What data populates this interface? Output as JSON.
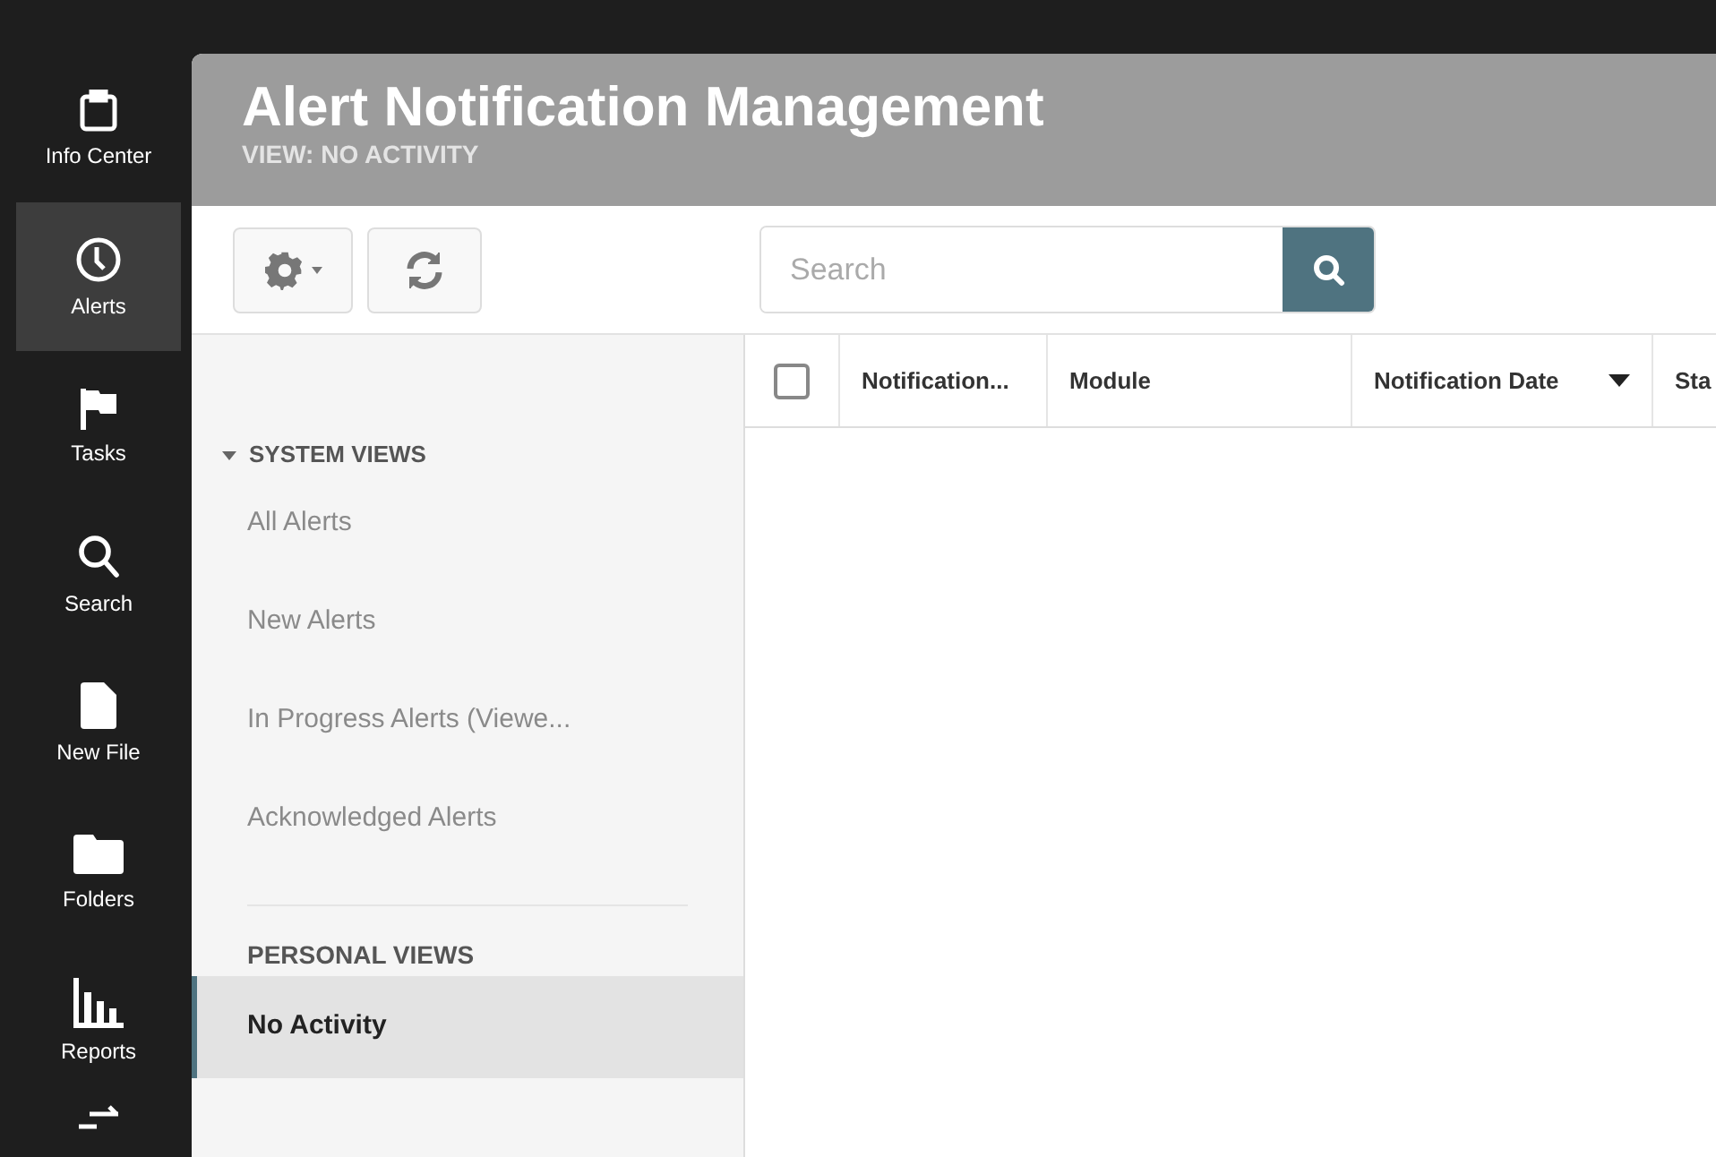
{
  "nav": [
    {
      "label": "Info Center",
      "kind": "clipboard",
      "selected": false
    },
    {
      "label": "Alerts",
      "kind": "clock",
      "selected": true
    },
    {
      "label": "Tasks",
      "kind": "flag",
      "selected": false
    },
    {
      "label": "Search",
      "kind": "search",
      "selected": false
    },
    {
      "label": "New File",
      "kind": "file",
      "selected": false
    },
    {
      "label": "Folders",
      "kind": "folder",
      "selected": false
    },
    {
      "label": "Reports",
      "kind": "chart",
      "selected": false
    }
  ],
  "header": {
    "title": "Alert Notification Management",
    "subtitle": "VIEW: NO ACTIVITY"
  },
  "search": {
    "placeholder": "Search"
  },
  "views": {
    "system_title": "SYSTEM VIEWS",
    "expanded": true,
    "system": [
      {
        "label": "All Alerts",
        "selected": false
      },
      {
        "label": "New Alerts",
        "selected": false
      },
      {
        "label": "In Progress Alerts (Viewe...",
        "selected": false
      },
      {
        "label": "Acknowledged Alerts",
        "selected": false
      }
    ],
    "personal_title": "PERSONAL VIEWS",
    "personal": [
      {
        "label": "No Activity",
        "selected": true
      }
    ]
  },
  "table": {
    "select_all_checked": false,
    "columns": [
      {
        "label": "Notification..."
      },
      {
        "label": "Module"
      },
      {
        "label": "Notification Date",
        "sorted": true
      },
      {
        "label": "Sta"
      }
    ]
  }
}
